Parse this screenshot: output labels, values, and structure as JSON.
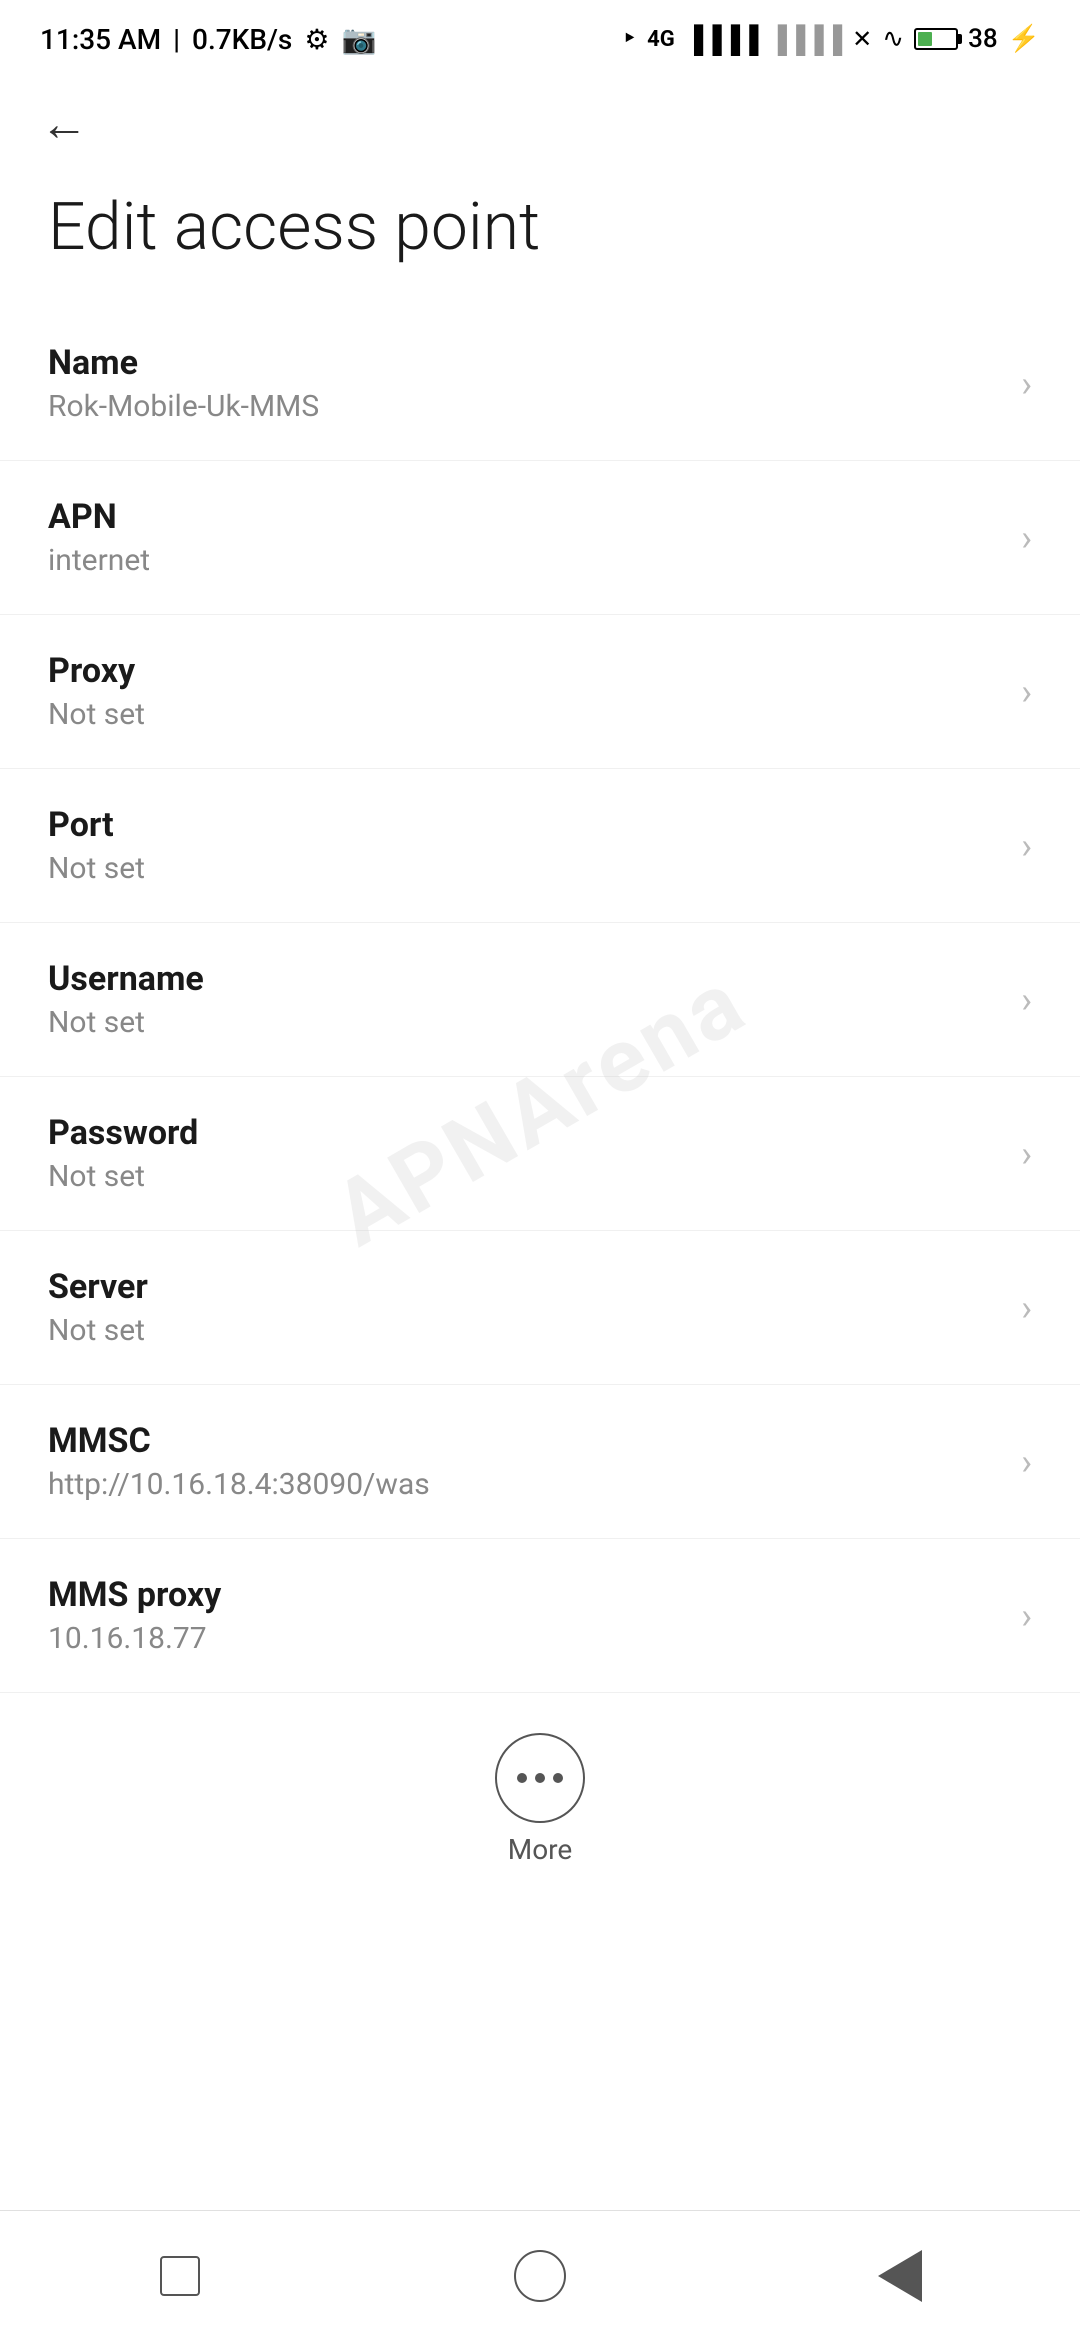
{
  "statusBar": {
    "time": "11:35 AM",
    "speed": "0.7KB/s"
  },
  "page": {
    "title": "Edit access point",
    "backArrow": "←"
  },
  "settings": [
    {
      "label": "Name",
      "value": "Rok-Mobile-Uk-MMS"
    },
    {
      "label": "APN",
      "value": "internet"
    },
    {
      "label": "Proxy",
      "value": "Not set"
    },
    {
      "label": "Port",
      "value": "Not set"
    },
    {
      "label": "Username",
      "value": "Not set"
    },
    {
      "label": "Password",
      "value": "Not set"
    },
    {
      "label": "Server",
      "value": "Not set"
    },
    {
      "label": "MMSC",
      "value": "http://10.16.18.4:38090/was"
    },
    {
      "label": "MMS proxy",
      "value": "10.16.18.77"
    }
  ],
  "more": {
    "label": "More"
  },
  "watermark": "APNArena"
}
